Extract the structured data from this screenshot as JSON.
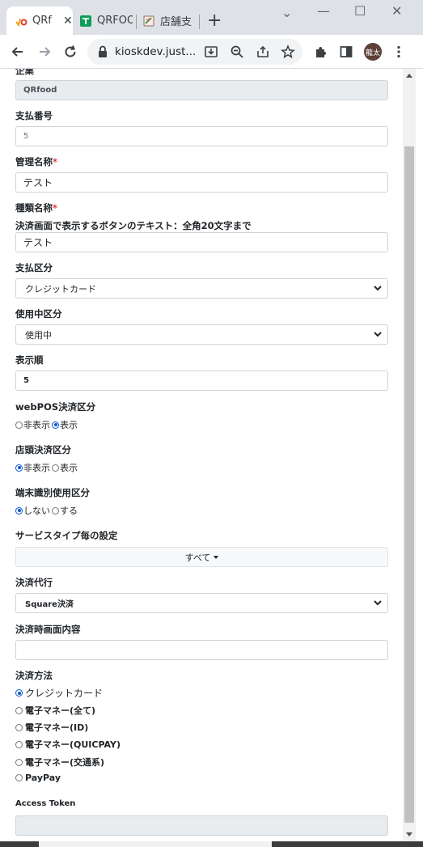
{
  "browser": {
    "tabs": [
      {
        "title": "QRf"
      },
      {
        "title": "QRFOO"
      },
      {
        "title": "店舗支"
      }
    ],
    "close_glyph": "✕",
    "new_tab_glyph": "+",
    "window": {
      "minimize": "—",
      "maximize": "☐",
      "close": "✕",
      "dropdown": "⌄"
    },
    "url": "kioskdev.just...",
    "avatar_text": "龍太",
    "accent_color": "#0b57d0"
  },
  "form": {
    "company_label": "企業",
    "company_value": "QRfood",
    "payment_no_label": "支払番号",
    "payment_no_value": "5",
    "admin_name_label": "管理名称",
    "admin_name_value": "テスト",
    "type_name_label": "種類名称",
    "type_name_help": "決済画面で表示するボタンのテキスト：全角20文字まで",
    "type_name_value": "テスト",
    "required_mark": "*",
    "payment_category_label": "支払区分",
    "payment_category_value": "クレジットカード",
    "in_use_label": "使用中区分",
    "in_use_value": "使用中",
    "display_order_label": "表示順",
    "display_order_value": "5",
    "webpos_label": "webPOS決済区分",
    "webpos_options": [
      "非表示",
      "表示"
    ],
    "webpos_selected": "表示",
    "store_label": "店頭決済区分",
    "store_options": [
      "非表示",
      "表示"
    ],
    "store_selected": "非表示",
    "terminal_label": "端末識別使用区分",
    "terminal_options": [
      "しない",
      "する"
    ],
    "terminal_selected": "しない",
    "service_type_label": "サービスタイプ毎の設定",
    "service_type_value": "すべて",
    "agent_label": "決済代行",
    "agent_value": "Square決済",
    "screen_content_label": "決済時画面内容",
    "screen_content_value": "",
    "method_label": "決済方法",
    "methods": [
      "クレジットカード",
      "電子マネー(全て)",
      "電子マネー(ID)",
      "電子マネー(QUICPAY)",
      "電子マネー(交通系)",
      "PayPay"
    ],
    "method_selected": "クレジットカード",
    "access_token_label": "Access Token",
    "access_token_value": ""
  }
}
